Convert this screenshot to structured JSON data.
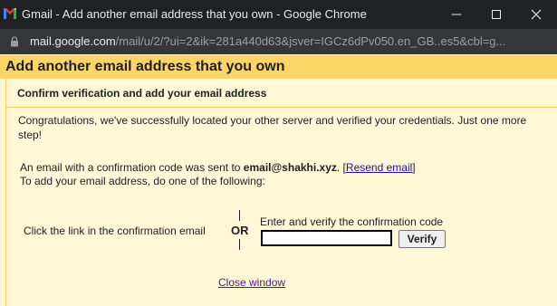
{
  "window": {
    "title": "Gmail - Add another email address that you own - Google Chrome",
    "minimize_icon": "minimize-icon",
    "maximize_icon": "maximize-icon",
    "close_icon": "close-icon"
  },
  "address_bar": {
    "url_host": "mail.google.com",
    "url_rest": "/mail/u/2/?ui=2&ik=281a440d63&jsver=IGCz6dPv050.en_GB..es5&cbl=g..."
  },
  "dialog": {
    "title": "Add another email address that you own",
    "section_title": "Confirm verification and add your email address",
    "congrats": "Congratulations, we've successfully located your other server and verified your credentials. Just one more step!",
    "sent_prefix": "An email with a confirmation code was sent to ",
    "sent_email": "email@shakhi.xyz",
    "sent_suffix": ". [",
    "resend_link": "Resend email",
    "sent_close": "]",
    "todo": "To add your email address, do one of the following:",
    "option_link": "Click the link in the confirmation email",
    "or": "OR",
    "enter_code": "Enter and verify the confirmation code",
    "code_value": "",
    "verify_button": "Verify",
    "close_window": "Close window"
  },
  "colors": {
    "header_bg": "#fdd466",
    "body_bg": "#fff8d6",
    "titlebar_bg": "#202124"
  }
}
